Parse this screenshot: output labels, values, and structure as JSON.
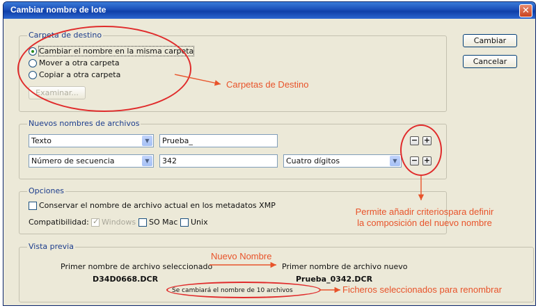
{
  "window": {
    "title": "Cambiar nombre de lote",
    "close_glyph": "✕"
  },
  "destination": {
    "legend": "Carpeta de destino",
    "options": [
      {
        "label": "Cambiar el nombre en la misma carpeta",
        "selected": true
      },
      {
        "label": "Mover a otra carpeta",
        "selected": false
      },
      {
        "label": "Copiar a otra carpeta",
        "selected": false
      }
    ],
    "browse_button": "Examinar..."
  },
  "buttons": {
    "rename": "Cambiar",
    "cancel": "Cancelar"
  },
  "new_names": {
    "legend": "Nuevos nombres de archivos",
    "rows": [
      {
        "type": "Texto",
        "value": "Prueba_",
        "format": ""
      },
      {
        "type": "Número de secuencia",
        "value": "342",
        "format": "Cuatro dígitos"
      }
    ],
    "remove_glyph": "−",
    "add_glyph": "+"
  },
  "options": {
    "legend": "Opciones",
    "keep_name_label": "Conservar el nombre de archivo actual en los metadatos XMP",
    "compat_label": "Compatibilidad:",
    "compat": [
      {
        "label": "Windows",
        "checked": true,
        "disabled": true
      },
      {
        "label": "SO Mac",
        "checked": false,
        "disabled": false
      },
      {
        "label": "Unix",
        "checked": false,
        "disabled": false
      }
    ]
  },
  "preview": {
    "legend": "Vista previa",
    "first_selected_label": "Primer nombre de archivo seleccionado",
    "first_selected_value": "D34D0668.DCR",
    "first_new_label": "Primer nombre de archivo nuevo",
    "first_new_value": "Prueba_0342.DCR",
    "count_text": "Se cambiará el nombre de 10 archivos"
  },
  "annotations": {
    "destino": "Carpetas de Destino",
    "criterios": "Permite añadir criteriospara definir la composición del nuevo nombre",
    "nuevo_nombre": "Nuevo Nombre",
    "ficheros": "Ficheros seleccionados para renombrar",
    "color": "#e8532a",
    "ellipse_color": "#e02b2b"
  }
}
